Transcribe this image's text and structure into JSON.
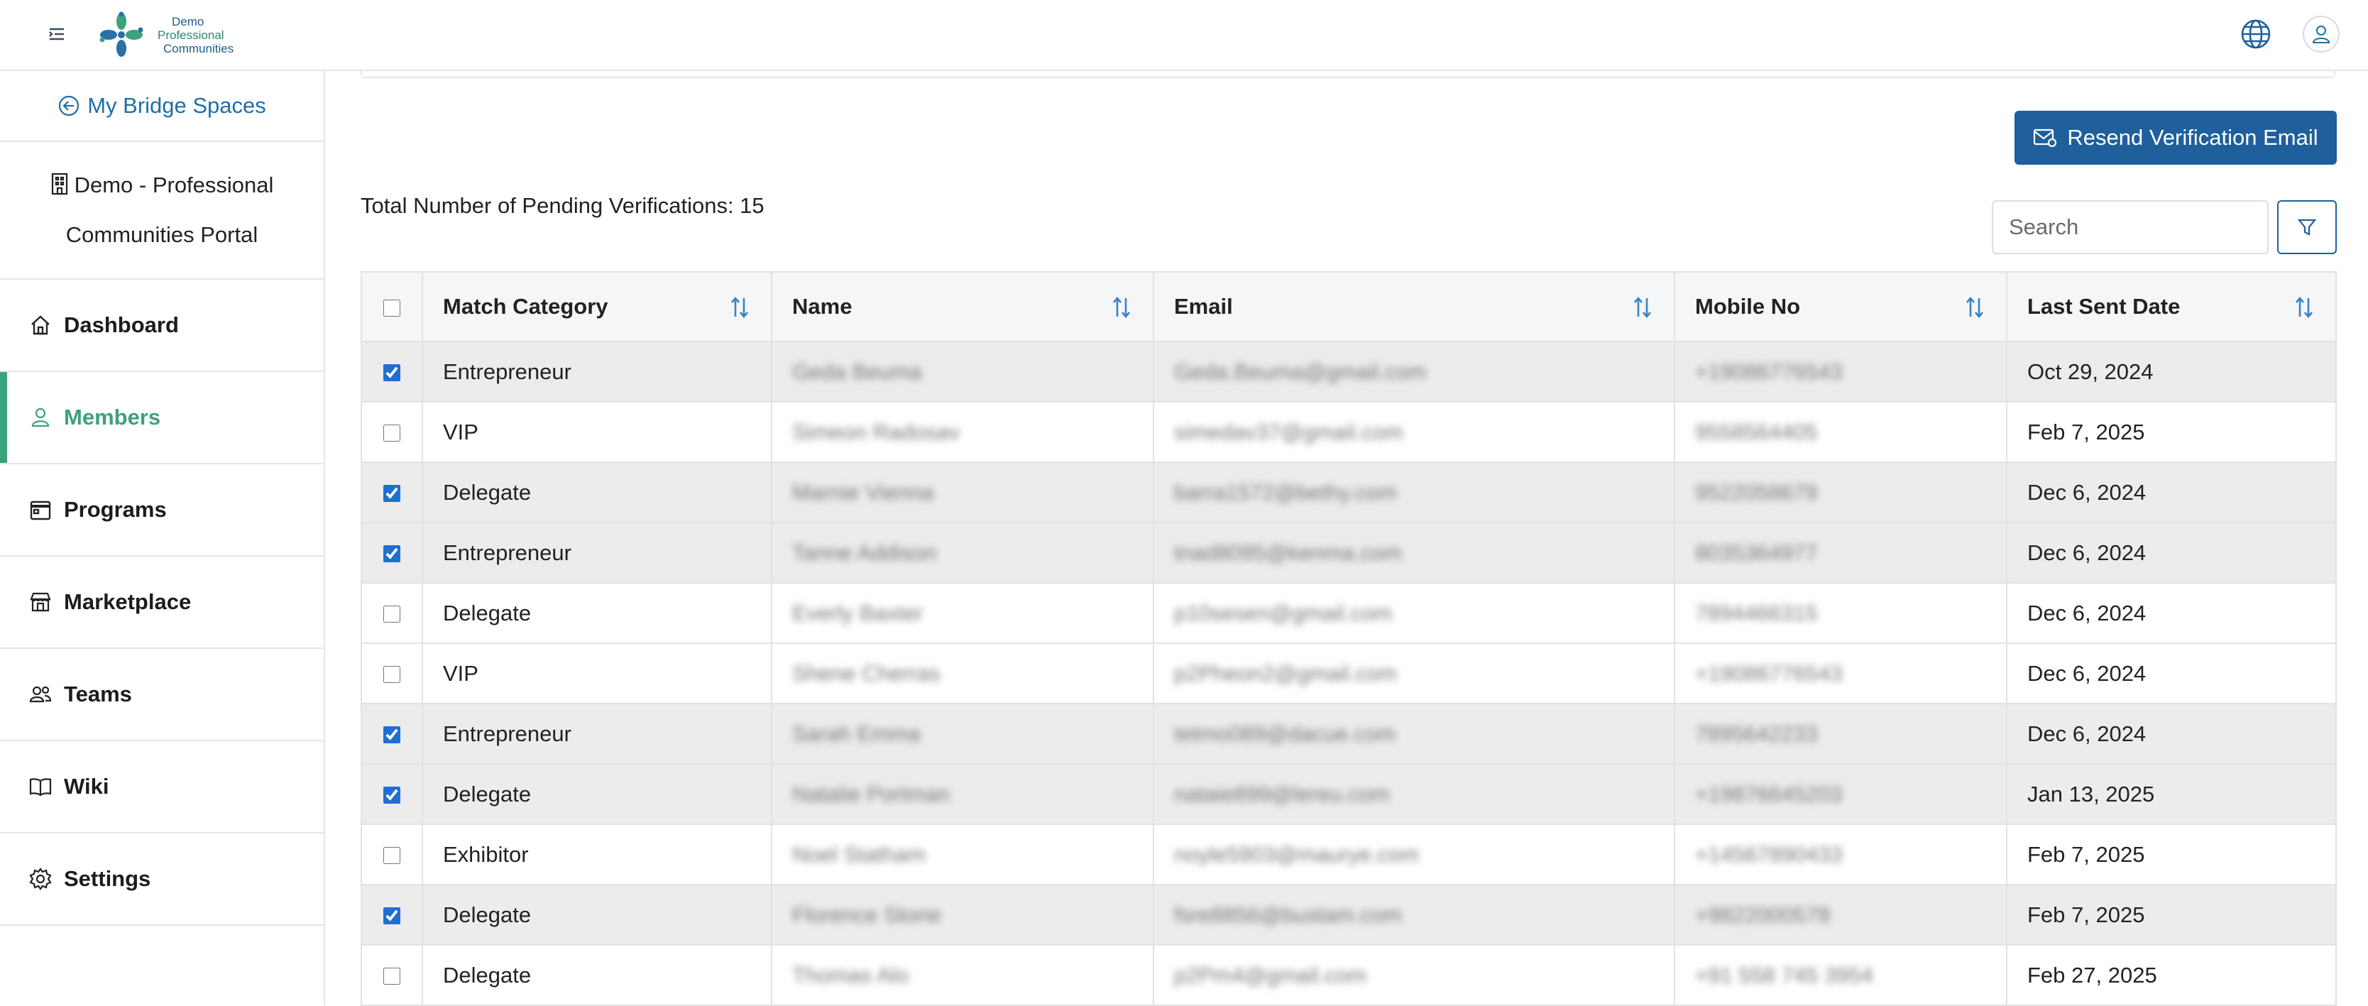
{
  "header": {
    "logo_lines": [
      "Demo",
      "Professional",
      "Communities"
    ]
  },
  "sidebar": {
    "back_label": "My Bridge Spaces",
    "portal_name": "Demo - Professional Communities Portal",
    "items": [
      {
        "label": "Dashboard",
        "icon": "home-icon"
      },
      {
        "label": "Members",
        "icon": "person-icon",
        "active": true
      },
      {
        "label": "Programs",
        "icon": "calendar-icon"
      },
      {
        "label": "Marketplace",
        "icon": "store-icon"
      },
      {
        "label": "Teams",
        "icon": "users-icon"
      },
      {
        "label": "Wiki",
        "icon": "book-icon"
      },
      {
        "label": "Settings",
        "icon": "gear-icon"
      }
    ]
  },
  "main": {
    "resend_label": "Resend Verification Email",
    "total_label": "Total Number of Pending Verifications: 15",
    "search_placeholder": "Search",
    "columns": [
      "Match Category",
      "Name",
      "Email",
      "Mobile No",
      "Last Sent Date"
    ],
    "rows": [
      {
        "checked": true,
        "category": "Entrepreneur",
        "name": "Geda Beuma",
        "email": "Geda.Beuma@gmail.com",
        "mobile": "+19086776543",
        "date": "Oct 29, 2024"
      },
      {
        "checked": false,
        "category": "VIP",
        "name": "Simeon Radosav",
        "email": "simedav37@gmail.com",
        "mobile": "9558564405",
        "date": "Feb 7, 2025"
      },
      {
        "checked": true,
        "category": "Delegate",
        "name": "Marnie Vienna",
        "email": "barra1572@bethy.com",
        "mobile": "9522058679",
        "date": "Dec 6, 2024"
      },
      {
        "checked": true,
        "category": "Entrepreneur",
        "name": "Tanne Addison",
        "email": "tnad8095@kenma.com",
        "mobile": "8035364977",
        "date": "Dec 6, 2024"
      },
      {
        "checked": false,
        "category": "Delegate",
        "name": "Everly Baxter",
        "email": "p10sesen@gmail.com",
        "mobile": "7894466315",
        "date": "Dec 6, 2024"
      },
      {
        "checked": false,
        "category": "VIP",
        "name": "Shene Cherras",
        "email": "p2Pheon2@gmail.com",
        "mobile": "+19086776543",
        "date": "Dec 6, 2024"
      },
      {
        "checked": true,
        "category": "Entrepreneur",
        "name": "Sarah Emma",
        "email": "tetmo089@dacue.com",
        "mobile": "7895642233",
        "date": "Dec 6, 2024"
      },
      {
        "checked": true,
        "category": "Delegate",
        "name": "Natalie Portman",
        "email": "nataie899@lereu.com",
        "mobile": "+19876645203",
        "date": "Jan 13, 2025"
      },
      {
        "checked": false,
        "category": "Exhibitor",
        "name": "Noel Statham",
        "email": "noyle5903@maurye.com",
        "mobile": "+14567890433",
        "date": "Feb 7, 2025"
      },
      {
        "checked": true,
        "category": "Delegate",
        "name": "Florence Stone",
        "email": "fsre8856@bustam.com",
        "mobile": "+9822000578",
        "date": "Feb 7, 2025"
      },
      {
        "checked": false,
        "category": "Delegate",
        "name": "Thomas Alo",
        "email": "p2Pm4@gmail.com",
        "mobile": "+91 558 745 3954",
        "date": "Feb 27, 2025"
      }
    ]
  },
  "colors": {
    "accent": "#1f5f9c",
    "active_nav": "#3aa37b",
    "link": "#1f6ea8"
  }
}
